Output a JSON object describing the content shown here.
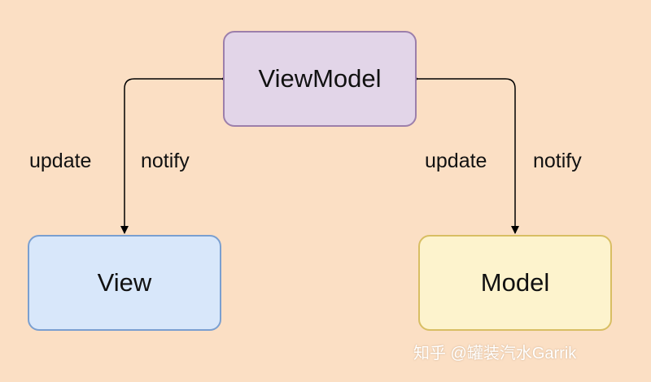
{
  "diagram": {
    "nodes": {
      "viewmodel": "ViewModel",
      "view": "View",
      "model": "Model"
    },
    "edges": {
      "left": {
        "update": "update",
        "notify": "notify"
      },
      "right": {
        "update": "update",
        "notify": "notify"
      }
    },
    "watermark": "知乎 @罐装汽水Garrik"
  },
  "colors": {
    "background": "#fbdfc4",
    "viewmodel_fill": "#e2d5e8",
    "view_fill": "#d8e7fa",
    "model_fill": "#fdf3cd",
    "arrow": "#000000"
  }
}
